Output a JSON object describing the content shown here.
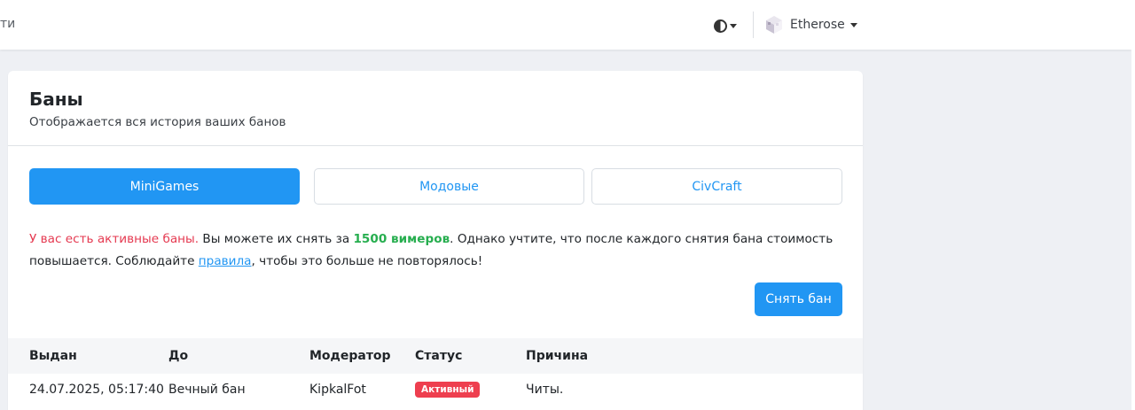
{
  "topbar": {
    "nav_text_fragment": "ти",
    "user": {
      "name": "Etherose"
    }
  },
  "card": {
    "title": "Баны",
    "subtitle": "Отображается вся история ваших банов"
  },
  "tabs": [
    {
      "label": "MiniGames",
      "active": true
    },
    {
      "label": "Модовые",
      "active": false
    },
    {
      "label": "CivCraft",
      "active": false
    }
  ],
  "notice": {
    "warning": "У вас есть активные баны.",
    "text_before_price": " Вы можете их снять за ",
    "price": "1500 вимеров",
    "text_after_price": ". Однако учтите, что после каждого снятия бана стоимость повышается. Соблюдайте ",
    "rules_link": "правила",
    "text_end": ", чтобы это больше не повторялось!"
  },
  "unban_button": "Снять бан",
  "table": {
    "headers": [
      "Выдан",
      "До",
      "Модератор",
      "Статус",
      "Причина"
    ],
    "rows": [
      {
        "issued": "24.07.2025, 05:17:40",
        "until": "Вечный бан",
        "moderator": "KipkalFot",
        "status": "Активный",
        "reason": "Читы."
      }
    ]
  },
  "colors": {
    "accent": "#2196f3",
    "warning": "#e53950",
    "price": "#27ae4f",
    "badge": "#ee3f4f"
  }
}
